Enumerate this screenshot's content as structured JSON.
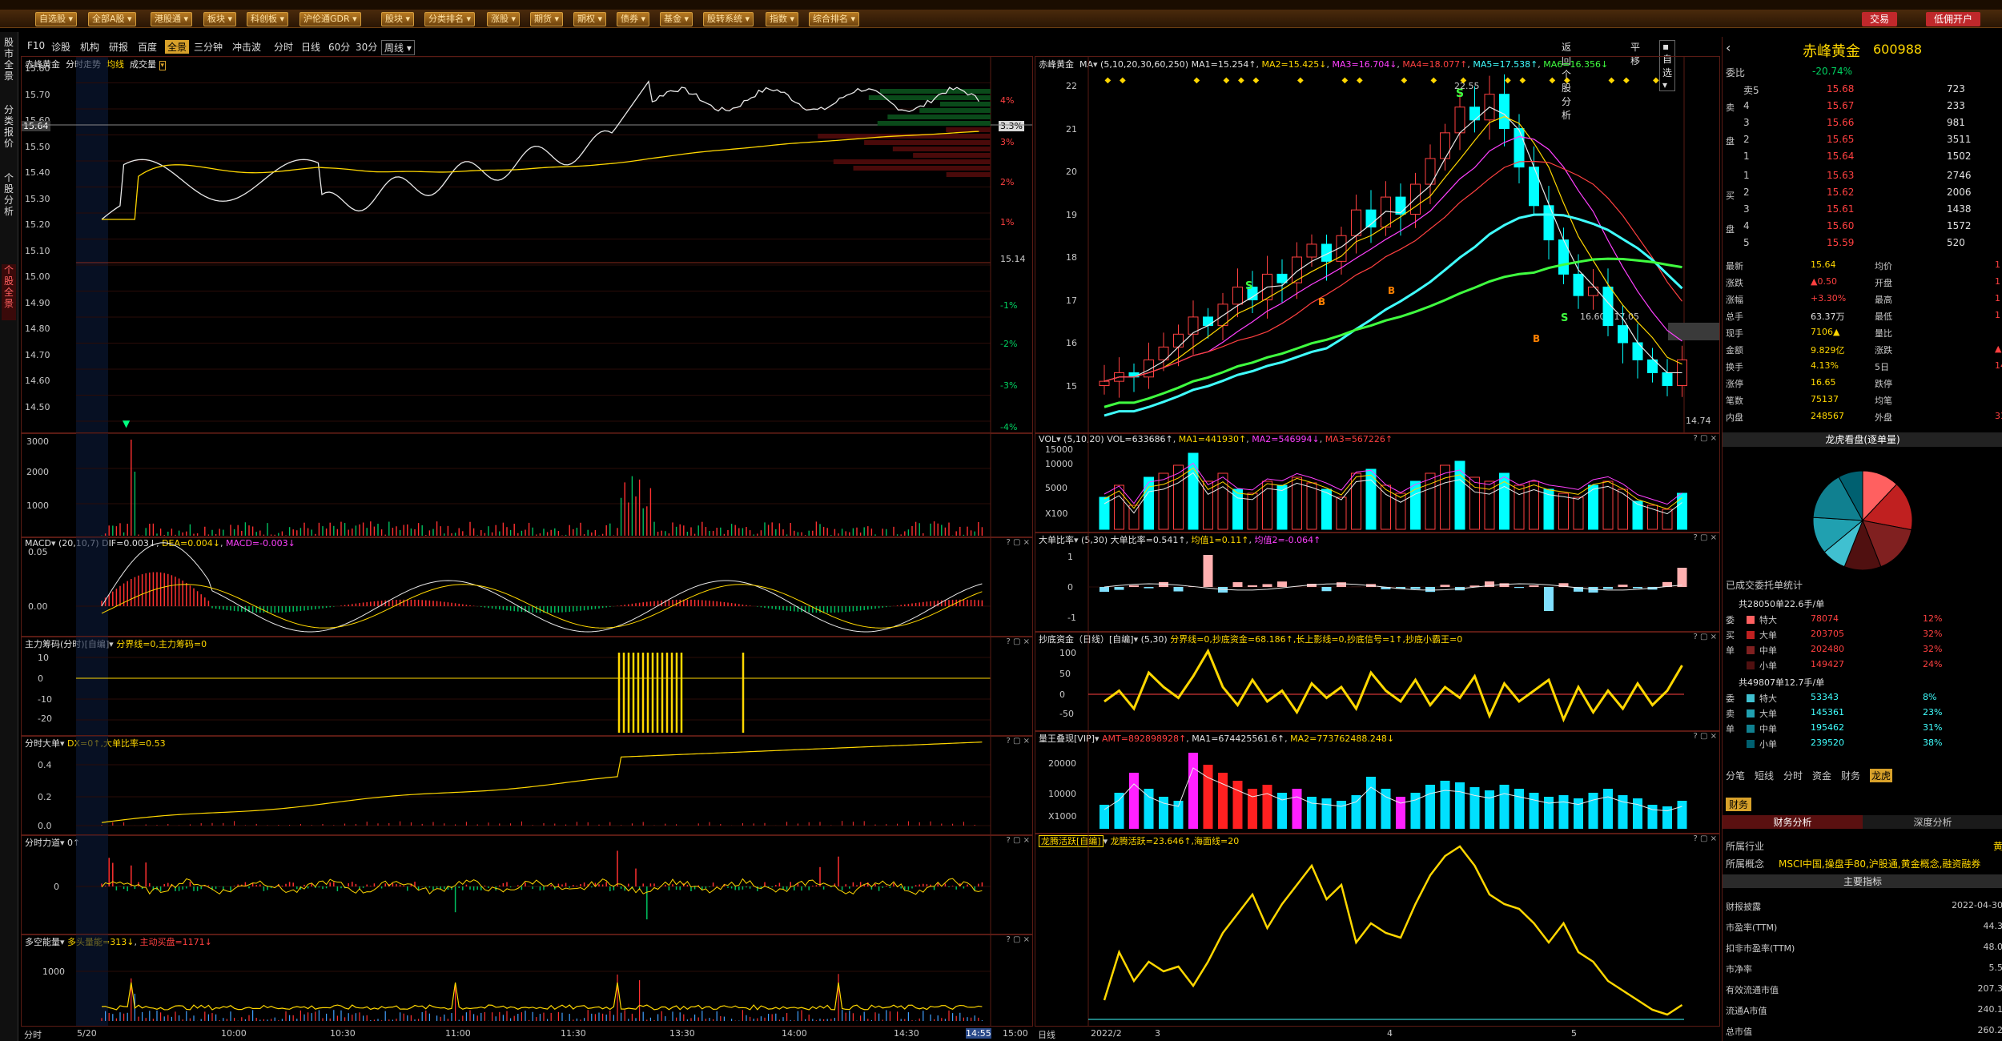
{
  "menubar": {
    "items": [
      "自选股",
      "全部A股",
      "港股通",
      "板块",
      "科创板",
      "沪伦通GDR",
      "股块",
      "分类排名",
      "涨股",
      "期货",
      "期权",
      "债券",
      "基金",
      "股转系统",
      "指数",
      "综合排名"
    ],
    "trade": "交易",
    "open_account": "低佣开户"
  },
  "lefttabs": [
    "股市全景",
    "分类报价",
    "个股分析",
    "个股全景"
  ],
  "toolbar": {
    "items": [
      "F10",
      "诊股",
      "机构",
      "研报",
      "百度",
      "全景",
      "三分钟",
      "冲击波",
      "分时",
      "日线",
      "60分",
      "30分"
    ],
    "period": "周线",
    "back": "返回个股分析",
    "flat": "平移",
    "selfpick": "自选"
  },
  "intraday": {
    "header_name": "赤峰黄金",
    "header_mode": "分时走势",
    "header_avg": "均线",
    "header_vol": "成交量",
    "price_ticks": [
      "15.80",
      "15.70",
      "15.60",
      "15.50",
      "15.40",
      "15.30",
      "15.20",
      "15.10",
      "15.00",
      "14.90",
      "14.80",
      "14.70",
      "14.60",
      "14.50"
    ],
    "current_price": "15.64",
    "pct_tag": "3.3%",
    "mid_price": "15.14",
    "pct_ticks": [
      "4%",
      "3%",
      "2%",
      "1%",
      "-1%",
      "-2%",
      "-3%",
      "-4%"
    ],
    "vol_ticks": [
      "3000",
      "2000",
      "1000"
    ],
    "macd_hdr": "MACD",
    "macd_params": "(20,10,7)",
    "macd_dif": "DIF=0.003↓",
    "macd_dea": "DEA=0.004↓",
    "macd_val": "MACD=-0.003↓",
    "macd_ticks": [
      "0.05",
      "0.00"
    ],
    "main_chip_hdr": "主力筹码(分时)[自编]",
    "main_chip_vals": "分界线=0,主力筹码=0",
    "chip_ticks": [
      "10",
      "0",
      "-10",
      "-20"
    ],
    "big_hdr": "分时大单",
    "big_vals": "DX=0↑,大单比率=0.53",
    "big_ticks": [
      "0.4",
      "0.2",
      "0.0"
    ],
    "force_hdr": "分时力道",
    "force_vals": "0↑",
    "force_ticks": [
      "0"
    ],
    "energy_hdr": "多空能量",
    "energy_bull": "多头量能=313↓",
    "energy_bear": "主动买盘=1171↓",
    "energy_ticks": [
      "1000"
    ],
    "time_ticks": [
      "5/20",
      "10:00",
      "10:30",
      "11:00",
      "11:30",
      "13:30",
      "14:00",
      "14:30",
      "14:55",
      "15:00"
    ],
    "footer": "分时"
  },
  "daily": {
    "header_name": "赤峰黄金",
    "ma_label": "MA",
    "ma_params": "(5,10,20,30,60,250)",
    "ma1": "MA1=15.254↑",
    "ma2": "MA2=15.425↓",
    "ma3": "MA3=16.704↓",
    "ma4": "MA4=18.077↑",
    "ma5": "MA5=17.538↑",
    "ma6": "MA6=16.356↓",
    "price_ticks": [
      "22",
      "21",
      "20",
      "19",
      "18",
      "17",
      "16",
      "15"
    ],
    "high_label": "22.55",
    "low_label": "14.74",
    "range_label": "16.60 - 17.05",
    "vol_hdr": "VOL",
    "vol_params": "(5,10,20)",
    "vol_val": "VOL=633686↑",
    "vol_ma1": "MA1=441930↑",
    "vol_ma2": "MA2=546994↓",
    "vol_ma3": "MA3=567226↑",
    "vol_ticks": [
      "15000",
      "10000",
      "5000",
      "X100"
    ],
    "ratio_hdr": "大单比率",
    "ratio_params": "(5,30)",
    "ratio_val": "大单比率=0.541↑",
    "ratio_avg1": "均值1=0.11↑",
    "ratio_avg2": "均值2=-0.064↑",
    "ratio_ticks": [
      "1",
      "0",
      "-1"
    ],
    "bottom_hdr": "抄底资金（日线）[自编]",
    "bottom_params": "(5,30)",
    "bottom_vals": "分界线=0,抄底资金=68.186↑,长上影线=0,抄底信号=1↑,抄底小霸王=0",
    "bottom_ticks": [
      "100",
      "50",
      "0",
      "-50"
    ],
    "king_hdr": "量王叠现[VIP]",
    "king_amt": "AMT=892898928↑",
    "king_ma1": "MA1=674425561.6↑",
    "king_ma2": "MA2=773762488.248↓",
    "king_ticks": [
      "20000",
      "10000",
      "X1000"
    ],
    "dragon_hdr": "龙腾活跃[自编]",
    "dragon_vals": "龙腾活跃=23.646↑,海面线=20",
    "month_ticks": [
      "2022/2",
      "3",
      "4",
      "5"
    ],
    "footer": "日线"
  },
  "quote": {
    "name": "赤峰黄金",
    "code": "600988",
    "ratio_label": "委比",
    "ratio_val": "-20.74%",
    "sells": [
      {
        "l": "卖5",
        "p": "15.68",
        "v": "723"
      },
      {
        "l": "4",
        "p": "15.67",
        "v": "233"
      },
      {
        "l": "3",
        "p": "15.66",
        "v": "981"
      },
      {
        "l": "2",
        "p": "15.65",
        "v": "3511"
      },
      {
        "l": "1",
        "p": "15.64",
        "v": "1502"
      }
    ],
    "buys": [
      {
        "l": "1",
        "p": "15.63",
        "v": "2746"
      },
      {
        "l": "2",
        "p": "15.62",
        "v": "2006"
      },
      {
        "l": "3",
        "p": "15.61",
        "v": "1438"
      },
      {
        "l": "4",
        "p": "15.60",
        "v": "1572"
      },
      {
        "l": "5",
        "p": "15.59",
        "v": "520"
      }
    ],
    "sell_side_labels": [
      "卖",
      "盘"
    ],
    "buy_side_labels": [
      "买",
      "盘"
    ],
    "stats": [
      {
        "k": "最新",
        "v": "15.64",
        "k2": "均价",
        "v2": "1"
      },
      {
        "k": "涨跌",
        "v": "▲0.50",
        "k2": "开盘",
        "v2": "1"
      },
      {
        "k": "涨幅",
        "v": "+3.30%",
        "k2": "最高",
        "v2": "1"
      },
      {
        "k": "总手",
        "v": "63.37万",
        "k2": "最低",
        "v2": "1"
      },
      {
        "k": "现手",
        "v": "7106▲",
        "k2": "量比",
        "v2": ""
      },
      {
        "k": "金额",
        "v": "9.829亿",
        "k2": "涨跌",
        "v2": "▲"
      },
      {
        "k": "换手",
        "v": "4.13%",
        "k2": "5日",
        "v2": "14."
      },
      {
        "k": "涨停",
        "v": "16.65",
        "k2": "跌停",
        "v2": ""
      },
      {
        "k": "笔数",
        "v": "75137",
        "k2": "均笔",
        "v2": ""
      },
      {
        "k": "内盘",
        "v": "248567",
        "k2": "外盘",
        "v2": "33"
      }
    ],
    "pie_title": "龙虎看盘(逐单量)",
    "order_title": "已成交委托单统计",
    "buy_total": "共28050单22.6手/单",
    "buy_side": "委买单",
    "buy_rows": [
      {
        "k": "特大",
        "v": "78074",
        "p": "12%"
      },
      {
        "k": "大单",
        "v": "203705",
        "p": "32%"
      },
      {
        "k": "中单",
        "v": "202480",
        "p": "32%"
      },
      {
        "k": "小单",
        "v": "149427",
        "p": "24%"
      }
    ],
    "sell_total": "共49807单12.7手/单",
    "sell_side": "委卖单",
    "sell_rows": [
      {
        "k": "特大",
        "v": "53343",
        "p": "8%"
      },
      {
        "k": "大单",
        "v": "145361",
        "p": "23%"
      },
      {
        "k": "中单",
        "v": "195462",
        "p": "31%"
      },
      {
        "k": "小单",
        "v": "239520",
        "p": "38%"
      }
    ],
    "tabs": [
      "分笔",
      "短线",
      "分时",
      "资金",
      "财务",
      "龙虎"
    ],
    "fin_tab": "财务",
    "fin_tabs": [
      "财务分析",
      "深度分析"
    ],
    "industry_k": "所属行业",
    "industry_v": "黄",
    "concept_k": "所属概念",
    "concept_v": "MSCI中国,操盘手80,沪股通,黄金概念,融资融券",
    "main_idx": "主要指标",
    "fin_rows": [
      {
        "k": "财报披露",
        "v": "2022-04-30"
      },
      {
        "k": "市盈率(TTM)",
        "v": "44.3"
      },
      {
        "k": "扣非市盈率(TTM)",
        "v": "48.0"
      },
      {
        "k": "市净率",
        "v": "5.5"
      },
      {
        "k": "有效流通市值",
        "v": "207.3"
      },
      {
        "k": "流通A市值",
        "v": "240.1"
      },
      {
        "k": "总市值",
        "v": "260.2"
      }
    ]
  },
  "colors": {
    "up": "#ff3030",
    "down": "#00ffff",
    "panel_border": "#5a1b14",
    "yellow": "#ffd700"
  }
}
